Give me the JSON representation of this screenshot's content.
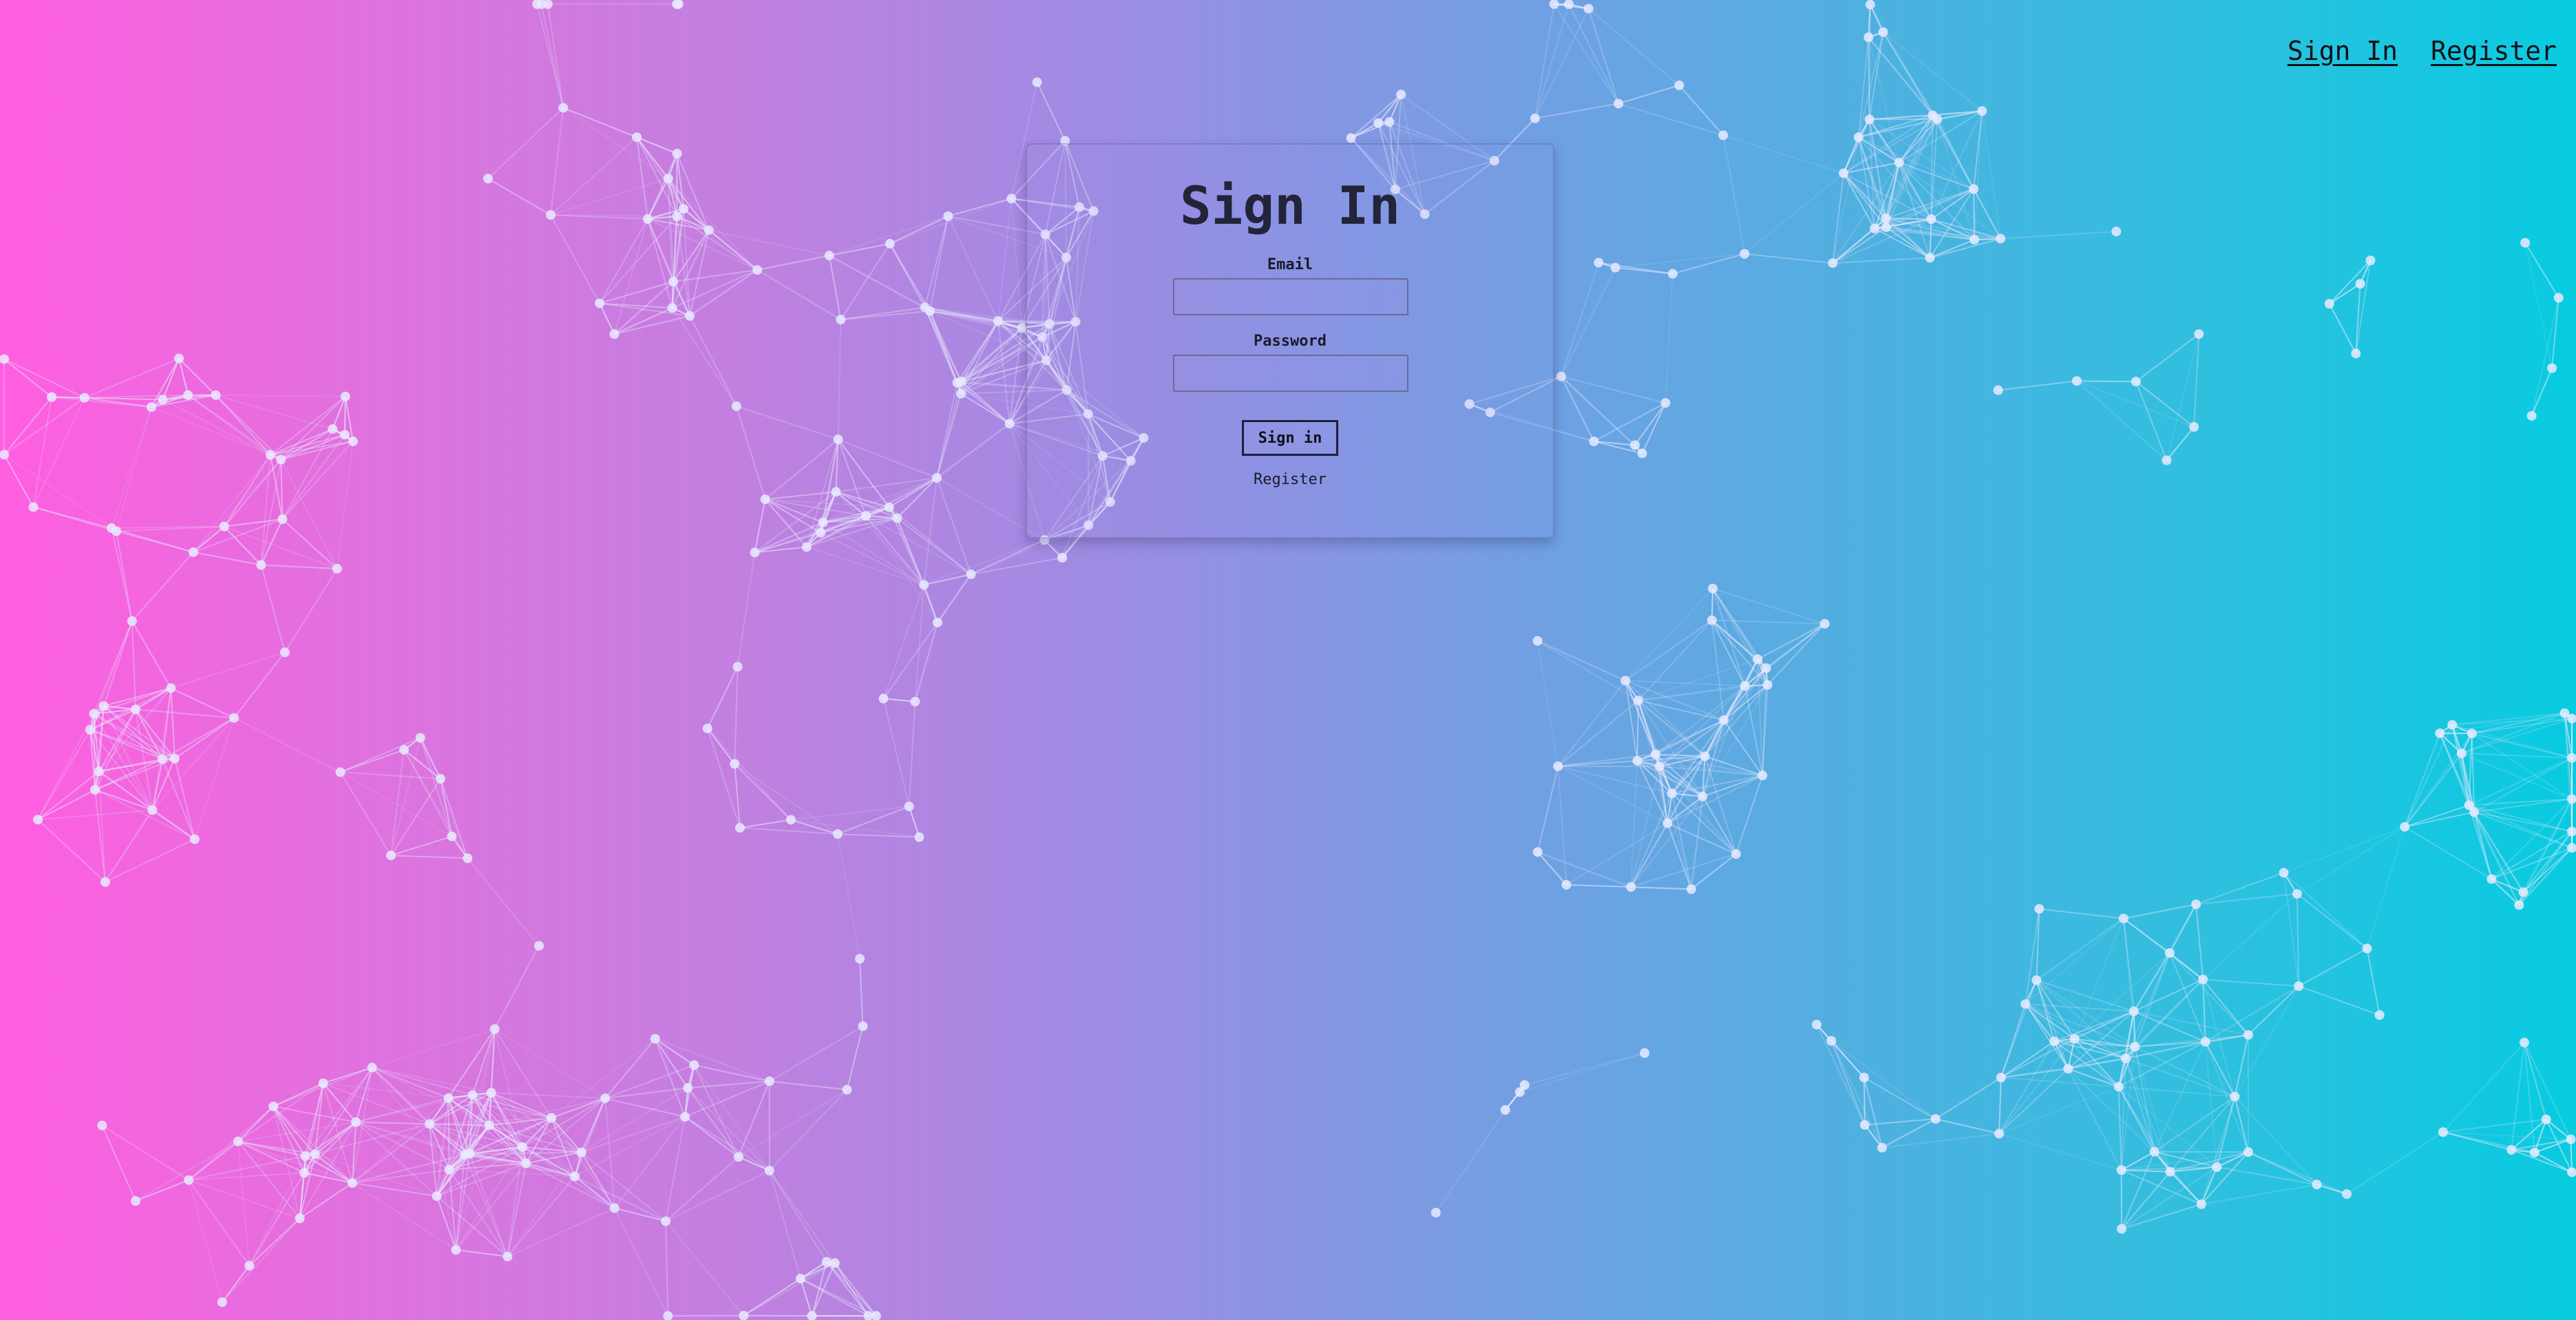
{
  "nav": {
    "sign_in": "Sign In",
    "register": "Register"
  },
  "form": {
    "title": "Sign In",
    "email_label": "Email",
    "email_value": "",
    "password_label": "Password",
    "password_value": "",
    "submit_label": "Sign in",
    "register_link": "Register"
  },
  "colors": {
    "gradient_start": "#ff5ee0",
    "gradient_mid": "#8a94e3",
    "gradient_end": "#08cbe0",
    "network_node": "#e8eaff",
    "text": "#111118"
  }
}
